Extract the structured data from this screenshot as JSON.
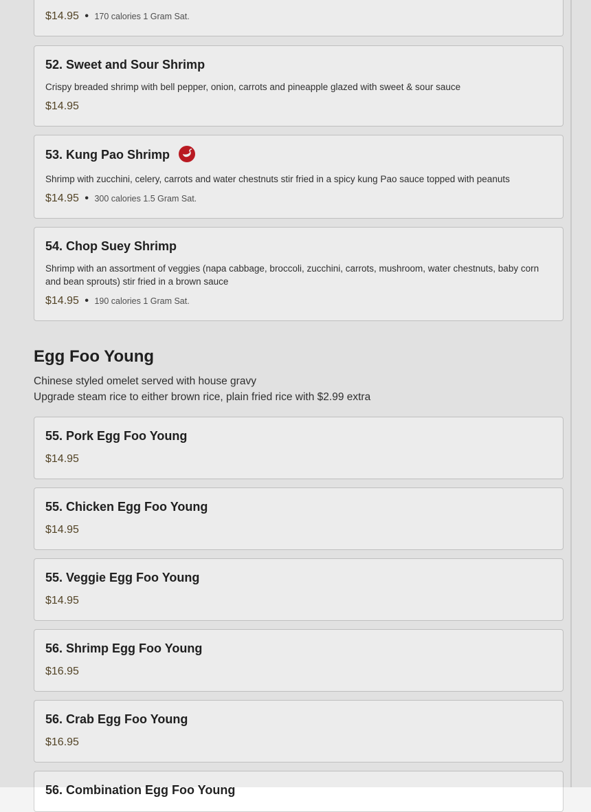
{
  "items": [
    {
      "name": "",
      "price": "$14.95",
      "calories": "170 calories 1 Gram Sat."
    },
    {
      "name": "52. Sweet and Sour Shrimp",
      "desc": "Crispy breaded shrimp with bell pepper, onion, carrots and pineapple glazed with sweet & sour sauce",
      "price": "$14.95"
    },
    {
      "name": "53. Kung Pao Shrimp",
      "desc": "Shrimp with zucchini, celery, carrots and water chestnuts stir fried in a spicy kung Pao sauce topped with peanuts",
      "price": "$14.95",
      "calories": "300 calories 1.5 Gram Sat.",
      "icon": "chili-pepper-icon"
    },
    {
      "name": "54. Chop Suey Shrimp",
      "desc": "Shrimp with an assortment of veggies (napa cabbage, broccoli, zucchini, carrots, mushroom, water chestnuts, baby corn and bean sprouts) stir fried in a brown sauce",
      "price": "$14.95",
      "calories": "190 calories 1 Gram Sat."
    }
  ],
  "section": {
    "title": "Egg Foo Young",
    "desc_line1": "Chinese styled omelet served with house gravy",
    "desc_line2": "Upgrade steam rice to either brown rice, plain fried rice with $2.99 extra"
  },
  "egg_items": [
    {
      "name": "55. Pork Egg Foo Young",
      "price": "$14.95"
    },
    {
      "name": "55. Chicken Egg Foo Young",
      "price": "$14.95"
    },
    {
      "name": "55. Veggie Egg Foo Young",
      "price": "$14.95"
    },
    {
      "name": "56. Shrimp Egg Foo Young",
      "price": "$16.95"
    },
    {
      "name": "56. Crab Egg Foo Young",
      "price": "$16.95"
    },
    {
      "name": "56. Combination Egg Foo Young",
      "price": ""
    }
  ],
  "dot": "•",
  "colors": {
    "spicy": "#c81d25",
    "price": "#5a4a2a"
  }
}
